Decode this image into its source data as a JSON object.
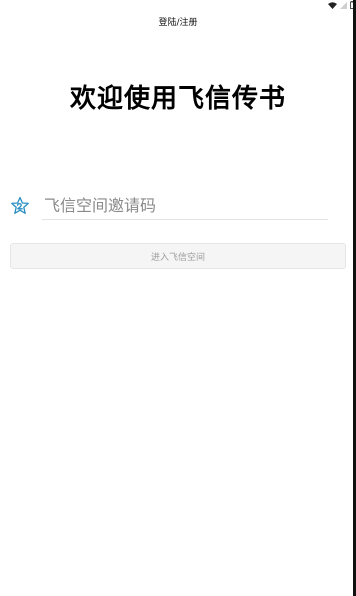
{
  "header": {
    "title": "登陆/注册"
  },
  "welcome": {
    "text": "欢迎使用飞信传书"
  },
  "invite": {
    "placeholder": "飞信空间邀请码",
    "value": "",
    "icon": "invite-star-icon"
  },
  "actions": {
    "enter_label": "进入飞信空间"
  },
  "status_bar": {
    "icons": [
      "wifi-icon",
      "signal-icon",
      "battery-icon"
    ]
  },
  "colors": {
    "accent": "#2a8fc0",
    "button_bg": "#f5f5f5",
    "button_text": "#9c9c9c"
  }
}
